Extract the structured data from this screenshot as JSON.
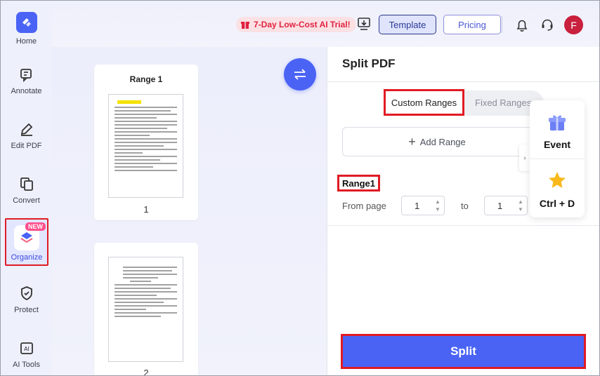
{
  "sidebar": {
    "items": [
      {
        "label": "Home",
        "icon": "home-logo-icon"
      },
      {
        "label": "Annotate",
        "icon": "annotate-icon"
      },
      {
        "label": "Edit PDF",
        "icon": "edit-pdf-icon"
      },
      {
        "label": "Convert",
        "icon": "convert-icon"
      },
      {
        "label": "Organize",
        "icon": "organize-icon",
        "badge": "NEW",
        "active": true
      },
      {
        "label": "Protect",
        "icon": "shield-icon"
      },
      {
        "label": "AI Tools",
        "icon": "ai-tools-icon"
      }
    ]
  },
  "topbar": {
    "trial_text": "7-Day Low-Cost AI Trial!",
    "template_label": "Template",
    "pricing_label": "Pricing",
    "avatar_initial": "F"
  },
  "preview": {
    "pages": [
      {
        "title": "Range 1",
        "page_number": "1"
      },
      {
        "title": "",
        "page_number": "2"
      }
    ]
  },
  "panel": {
    "title": "Split PDF",
    "tabs": {
      "custom": "Custom Ranges",
      "fixed": "Fixed Ranges"
    },
    "add_range_label": "Add Range",
    "range": {
      "label": "Range1",
      "from_label": "From page",
      "from_value": "1",
      "to_label": "to",
      "to_value": "1"
    },
    "split_label": "Split"
  },
  "float_card": {
    "event_label": "Event",
    "shortcut_label": "Ctrl + D"
  },
  "colors": {
    "accent": "#4a63f5",
    "highlight_border": "#e01b24",
    "trial_text": "#e0223f",
    "avatar": "#c8203d"
  }
}
